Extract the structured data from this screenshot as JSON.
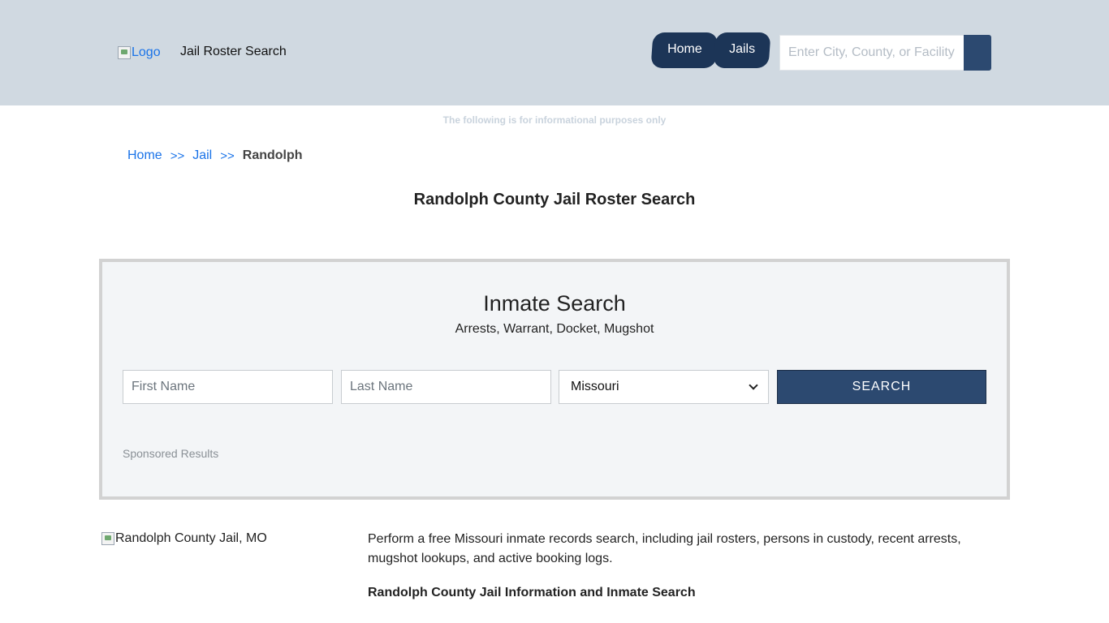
{
  "header": {
    "logo_alt": "Logo",
    "brand": "Jail Roster Search",
    "nav": [
      {
        "label": "Home"
      },
      {
        "label": "Jails"
      }
    ],
    "search_placeholder": "Enter City, County, or Facility"
  },
  "info_text": "The following is for informational purposes only",
  "breadcrumb": {
    "items": [
      "Home",
      "Jail"
    ],
    "separator": ">>",
    "current": "Randolph"
  },
  "page_title": "Randolph County Jail Roster Search",
  "inmate_search": {
    "title": "Inmate Search",
    "subtitle": "Arrests, Warrant, Docket, Mugshot",
    "first_name_placeholder": "First Name",
    "last_name_placeholder": "Last Name",
    "state_selected": "Missouri",
    "submit_label": "SEARCH",
    "sponsored": "Sponsored Results"
  },
  "content": {
    "image_alt": "Randolph County Jail, MO",
    "intro": "Perform a free Missouri inmate records search, including jail rosters, persons in custody, recent arrests, mugshot lookups, and active booking logs.",
    "section_heading": "Randolph County Jail Information and Inmate Search"
  },
  "colors": {
    "header_bg": "#d0d9e1",
    "nav_bg": "#1c3557",
    "button_bg": "#2c4970",
    "link": "#1a73e8"
  }
}
